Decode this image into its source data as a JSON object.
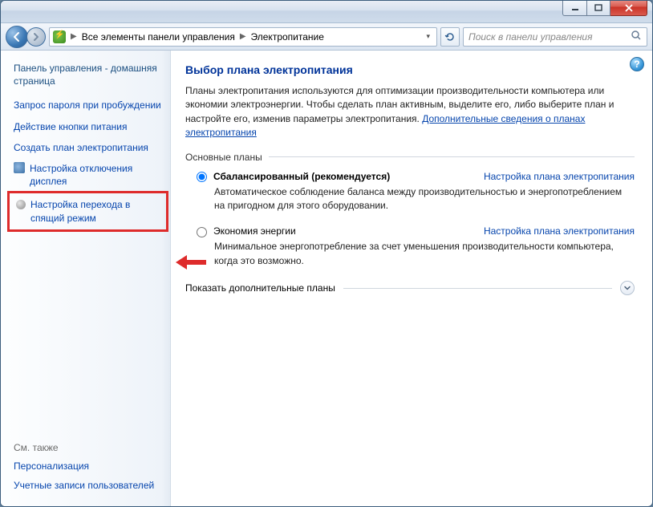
{
  "titlebar": {},
  "addressbar": {
    "crumb1": "Все элементы панели управления",
    "crumb2": "Электропитание",
    "search_placeholder": "Поиск в панели управления"
  },
  "sidebar": {
    "home": "Панель управления - домашняя страница",
    "links": [
      "Запрос пароля при пробуждении",
      "Действие кнопки питания",
      "Создать план электропитания",
      "Настройка отключения дисплея",
      "Настройка перехода в спящий режим"
    ],
    "seealso_h": "См. также",
    "seealso": [
      "Персонализация",
      "Учетные записи пользователей"
    ]
  },
  "main": {
    "title": "Выбор плана электропитания",
    "intro_before": "Планы электропитания используются для оптимизации производительности компьютера или экономии электроэнергии. Чтобы сделать план активным, выделите его, либо выберите план и настройте его, изменив параметры электропитания. ",
    "intro_link": "Дополнительные сведения о планах электропитания",
    "section1": "Основные планы",
    "plans": [
      {
        "name": "Сбалансированный (рекомендуется)",
        "link": "Настройка плана электропитания",
        "desc": "Автоматическое соблюдение баланса между производительностью и энергопотреблением на пригодном для этого оборудовании."
      },
      {
        "name": "Экономия энергии",
        "link": "Настройка плана электропитания",
        "desc": "Минимальное энергопотребление за счет уменьшения производительности компьютера, когда это возможно."
      }
    ],
    "expander": "Показать дополнительные планы"
  }
}
